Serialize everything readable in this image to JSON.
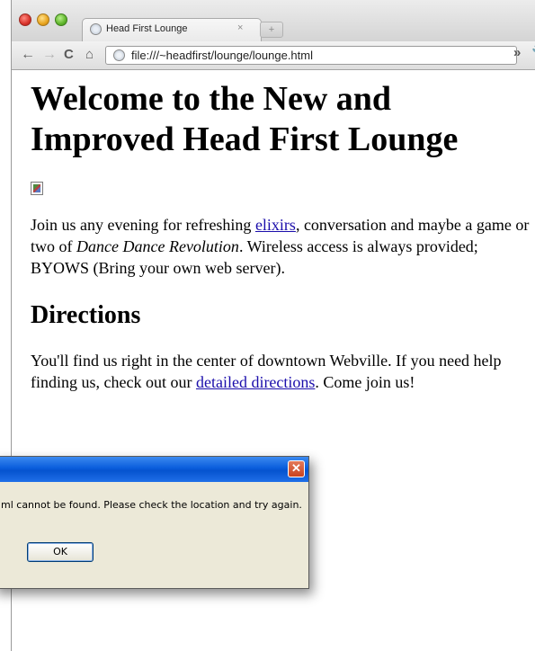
{
  "browser": {
    "tab": {
      "title": "Head First Lounge",
      "close": "×"
    },
    "newtab_label": "+",
    "nav": {
      "back": "←",
      "forward": "→",
      "reload": "C",
      "home": "⌂",
      "overflow": "»",
      "wrench": "🔧"
    },
    "url": "file:///~headfirst/lounge/lounge.html"
  },
  "page": {
    "heading": "Welcome to the New and Improved Head First Lounge",
    "intro": {
      "before_link": "Join us any evening for refreshing ",
      "link": "elixirs",
      "middle": ", conversation and maybe a game or two of ",
      "em": "Dance Dance Revolution",
      "after": ". Wireless access is always provided; BYOWS (Bring your own web server)."
    },
    "directions_heading": "Directions",
    "directions": {
      "before_link": "You'll find us right in the center of downtown Webville. If you need help finding us, check out our ",
      "link": "detailed directions",
      "after": ". Come join us!"
    }
  },
  "dialog": {
    "close": "✕",
    "message": "ml cannot be found. Please check the location and try again.",
    "ok_label": "OK"
  }
}
